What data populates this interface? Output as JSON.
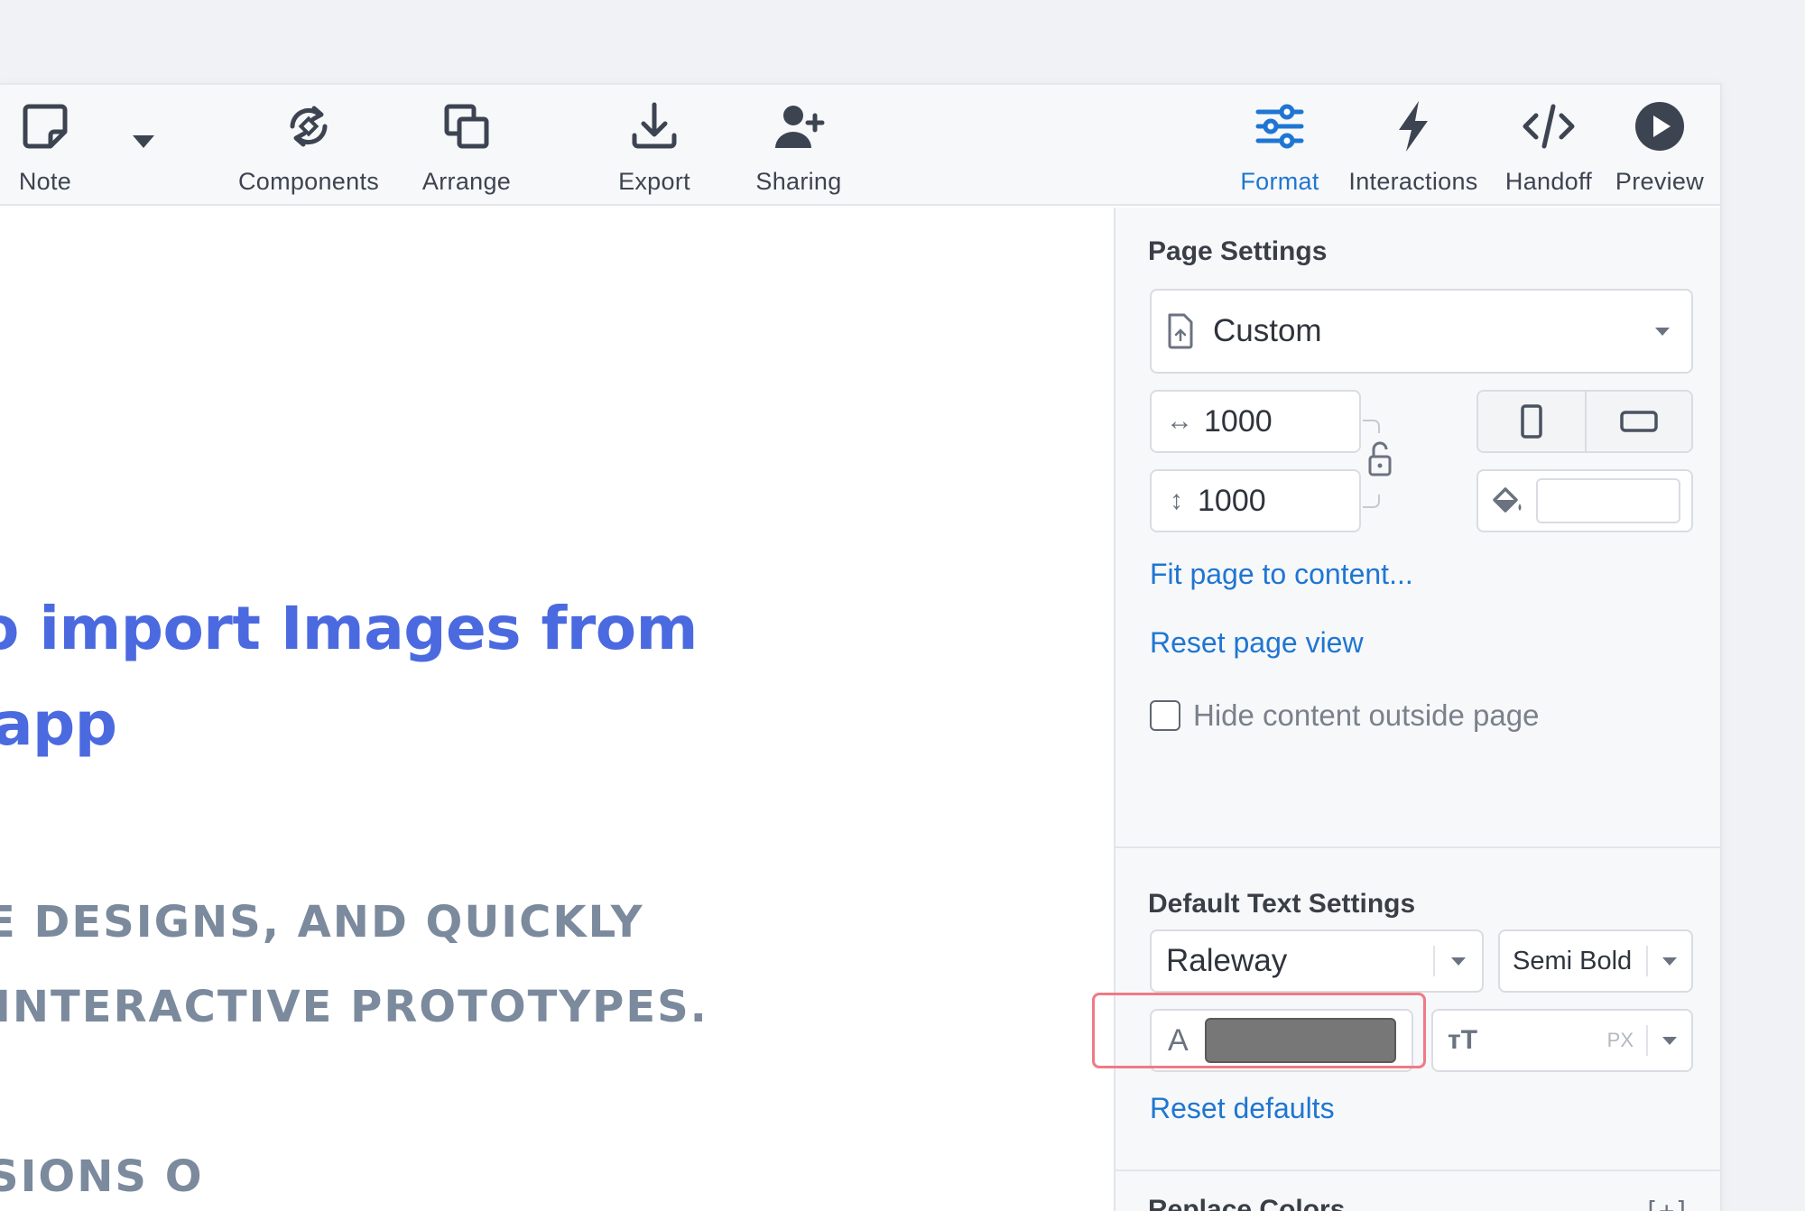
{
  "toolbar": {
    "left_tools": [
      {
        "label": "Note",
        "icon": "note-icon"
      },
      {
        "label": "Components",
        "icon": "components-icon"
      },
      {
        "label": "Arrange",
        "icon": "arrange-icon"
      },
      {
        "label": "Export",
        "icon": "export-icon"
      },
      {
        "label": "Sharing",
        "icon": "sharing-icon"
      }
    ],
    "right_tools": [
      {
        "label": "Format",
        "icon": "format-icon",
        "active": true
      },
      {
        "label": "Interactions",
        "icon": "interactions-icon"
      },
      {
        "label": "Handoff",
        "icon": "handoff-icon"
      },
      {
        "label": "Preview",
        "icon": "preview-icon"
      }
    ],
    "active_color": "#1f76d2"
  },
  "canvas": {
    "headline_line1": "o import Images from",
    "headline_line2": " app",
    "sub_line1": "E DESIGNS, AND QUICKLY",
    "sub_line2": " INTERACTIVE PROTOTYPES.",
    "sub_line3": "SIONS O",
    "headline_color": "#4b6ae0",
    "sub_color": "#7b8a9d"
  },
  "panel": {
    "page_settings": {
      "title": "Page Settings",
      "preset_value": "Custom",
      "width_value": "1000",
      "height_value": "1000",
      "fit_link": "Fit page to content...",
      "reset_view_link": "Reset page view",
      "hide_content_label": "Hide content outside page",
      "hide_content_checked": false
    },
    "text_settings": {
      "title": "Default Text Settings",
      "font_family": "Raleway",
      "font_weight": "Semi Bold",
      "text_color": "#777777",
      "size_unit": "PX",
      "reset_link": "Reset defaults"
    },
    "replace_colors": {
      "title": "Replace Colors",
      "expand_label": "[+]"
    }
  }
}
